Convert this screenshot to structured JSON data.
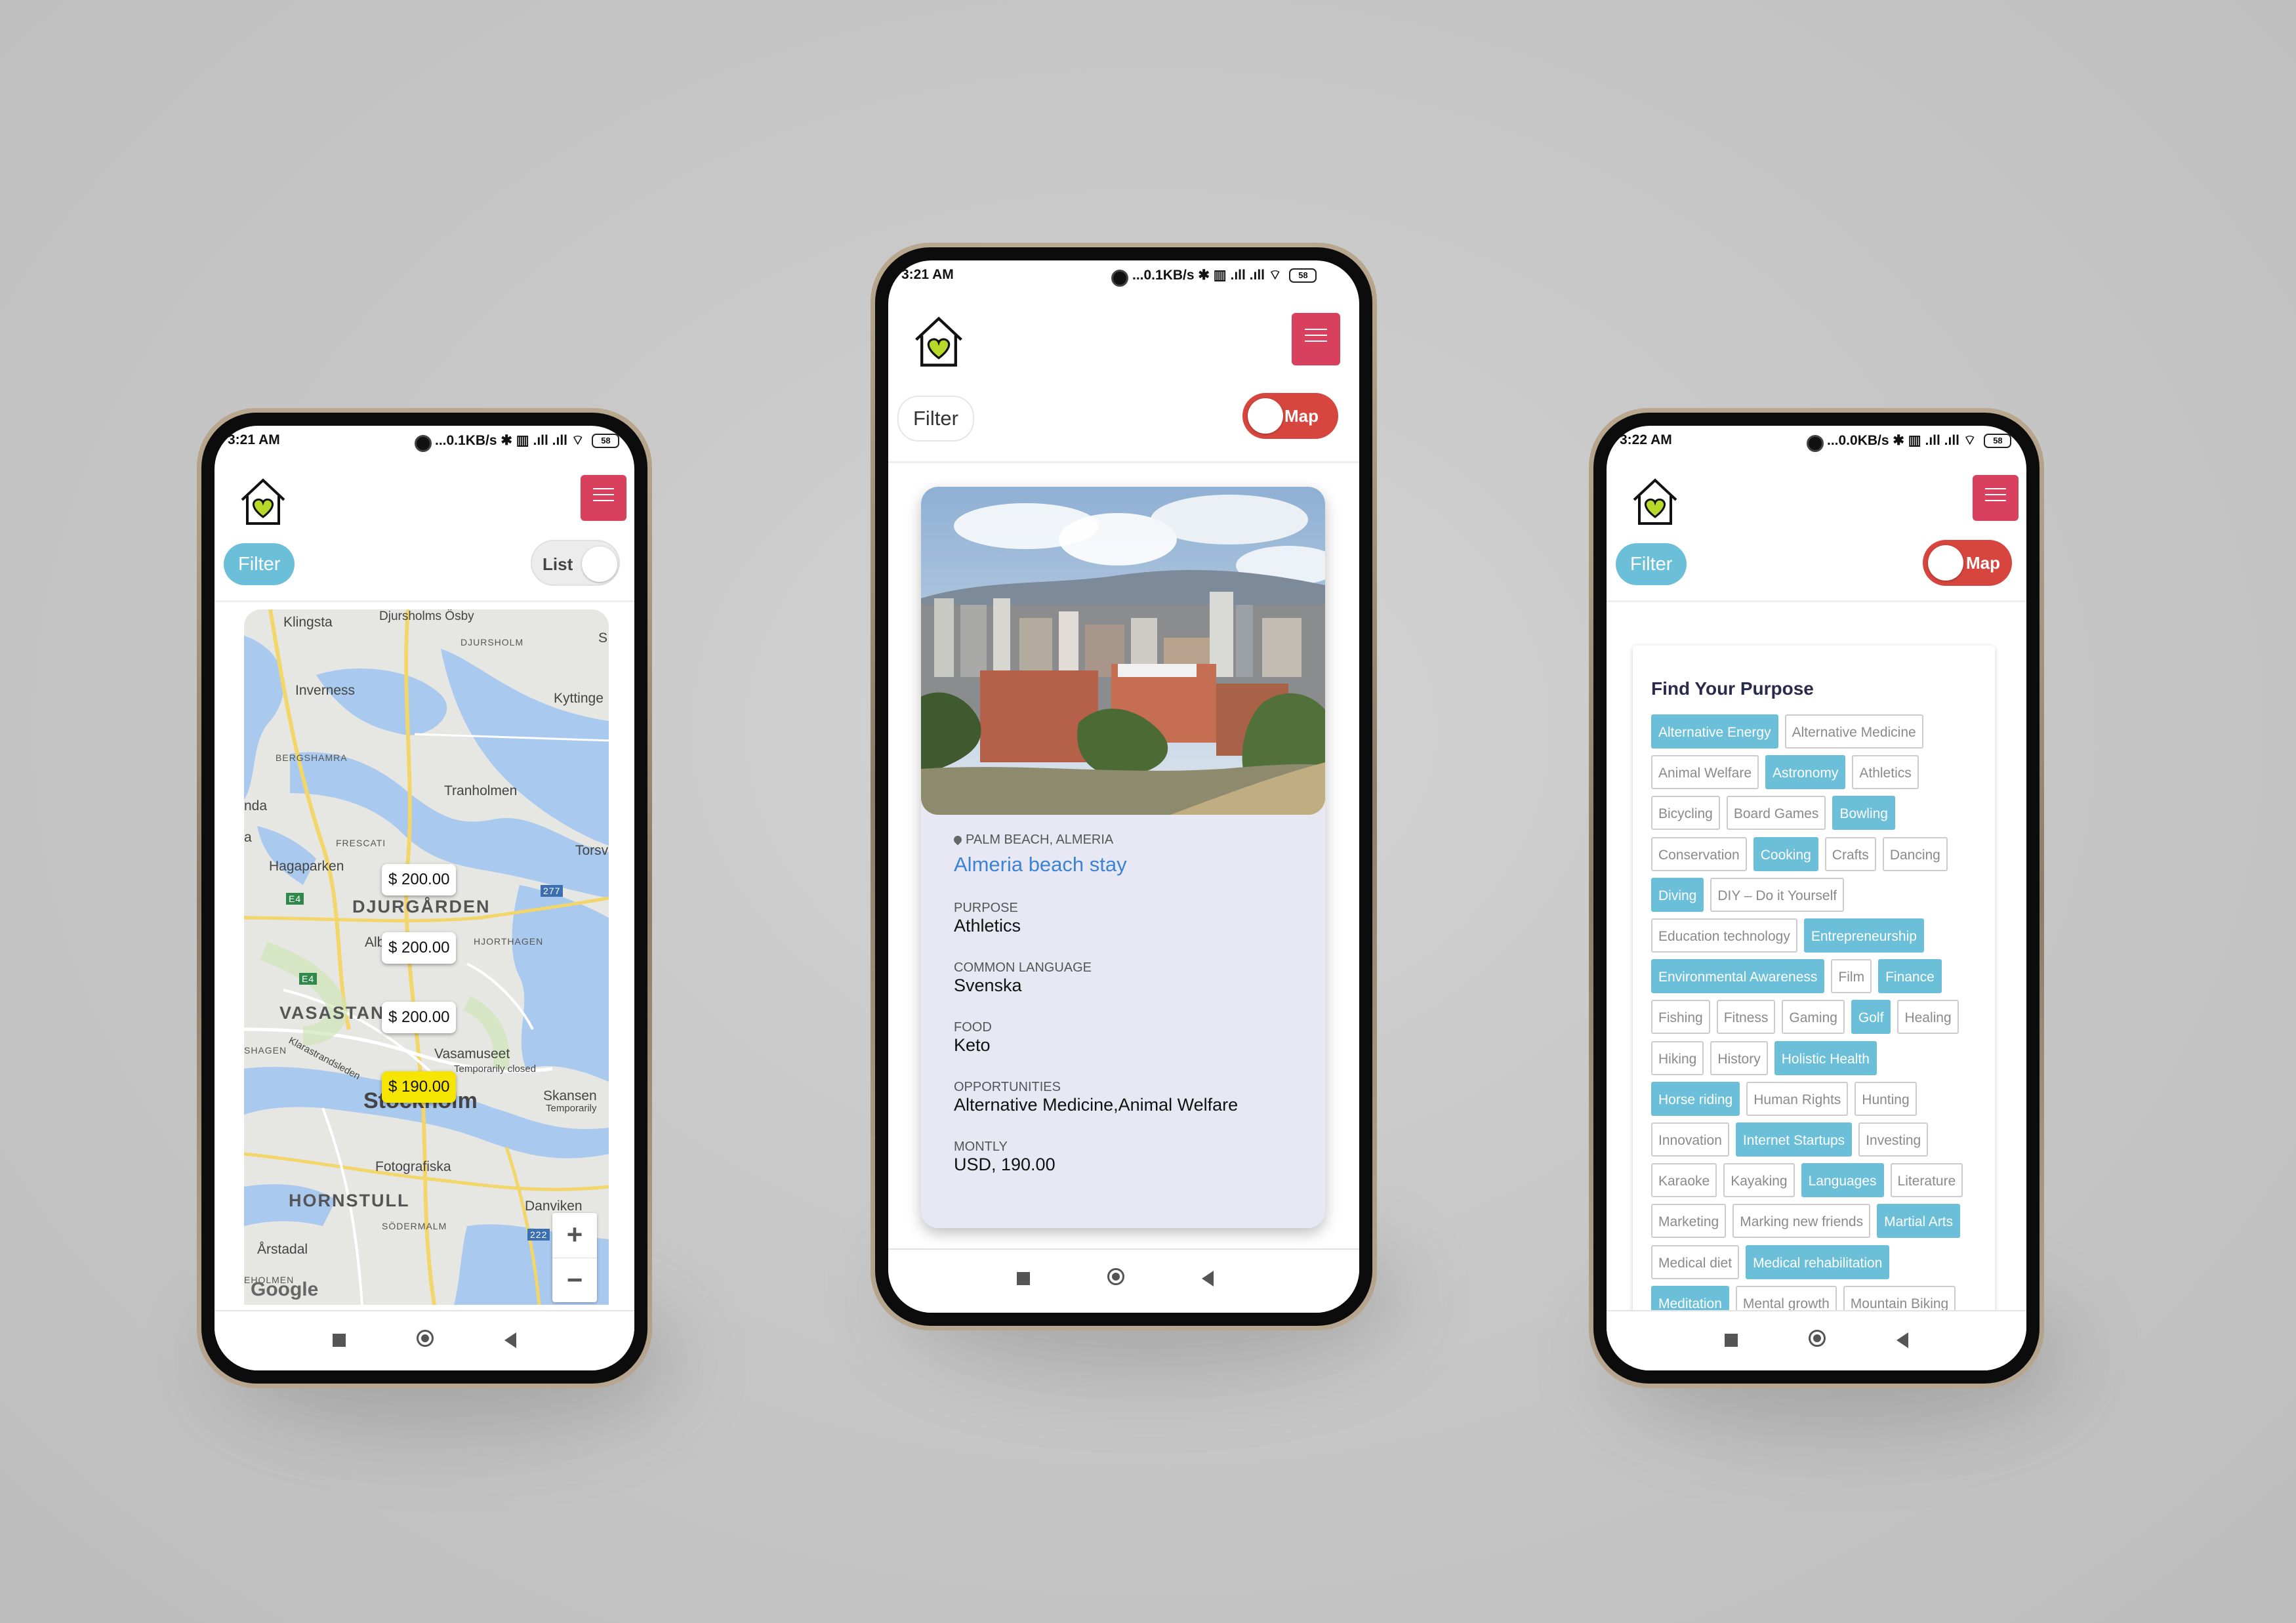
{
  "colors": {
    "accent_blue": "#6bbfd9",
    "brand_red": "#d8405e",
    "toggle_red": "#d6453e",
    "link_blue": "#3c83d4",
    "selected_pin": "#f5e500",
    "card_bg": "#e8e8f4"
  },
  "phone_left": {
    "status": {
      "time": "3:21 AM",
      "icons": "...0.1KB/s ✱ ▥ .ıll .ıll ⌔",
      "battery": "58"
    },
    "header": {
      "logo_icon": "house-heart-icon",
      "menu_icon": "hamburger-icon"
    },
    "filter_label": "Filter",
    "toggle_label": "List",
    "map": {
      "places": [
        "Klingsta",
        "Djursholms Ösby",
        "DJURSHOLM",
        "Inverness",
        "Kyttinge",
        "BERGSHAMRA",
        "Tranholmen",
        "nda",
        "a",
        "FRESCATI",
        "Torsv",
        "Hagaparken",
        "DJURGÅRDEN",
        "Alb",
        "HJORTHAGEN",
        "VASASTAN",
        "SHAGEN",
        "Klarastrandsleden",
        "Vasamuseet",
        "Temporarily closed",
        "Skansen",
        "Temporarily",
        "Stockholm",
        "Fotografiska",
        "HORNSTULL",
        "Danviken",
        "SÖDERMALM",
        "Årstadal",
        "EHOLMEN",
        "S",
        "Google"
      ],
      "road_badges": [
        "E4",
        "E4",
        "277",
        "222"
      ],
      "pins": [
        "$ 200.00",
        "$ 200.00",
        "$ 200.00",
        "$ 190.00"
      ],
      "zoom_in": "+",
      "zoom_out": "−"
    }
  },
  "phone_center": {
    "status": {
      "time": "3:21 AM",
      "icons": "...0.1KB/s ✱ ▥ .ıll .ıll ⌔",
      "battery": "58"
    },
    "filter_label": "Filter",
    "toggle_label": "Map",
    "listing": {
      "location": "PALM BEACH, ALMERIA",
      "title": "Almeria beach stay",
      "fields": [
        {
          "label": "PURPOSE",
          "value": "Athletics"
        },
        {
          "label": "COMMON LANGUAGE",
          "value": "Svenska"
        },
        {
          "label": "FOOD",
          "value": "Keto"
        },
        {
          "label": "OPPORTUNITIES",
          "value": "Alternative Medicine,Animal Welfare"
        },
        {
          "label": "MONTLY",
          "value": "USD, 190.00"
        }
      ]
    }
  },
  "phone_right": {
    "status": {
      "time": "3:22 AM",
      "icons": "...0.0KB/s ✱ ▥ .ıll .ıll ⌔",
      "battery": "58"
    },
    "filter_label": "Filter",
    "toggle_label": "Map",
    "purpose_title": "Find Your Purpose",
    "chips": [
      {
        "label": "Alternative Energy",
        "selected": true
      },
      {
        "label": "Alternative Medicine",
        "selected": false
      },
      {
        "label": "Animal Welfare",
        "selected": false
      },
      {
        "label": "Astronomy",
        "selected": true
      },
      {
        "label": "Athletics",
        "selected": false
      },
      {
        "label": "Bicycling",
        "selected": false
      },
      {
        "label": "Board Games",
        "selected": false
      },
      {
        "label": "Bowling",
        "selected": true
      },
      {
        "label": "Conservation",
        "selected": false
      },
      {
        "label": "Cooking",
        "selected": true
      },
      {
        "label": "Crafts",
        "selected": false
      },
      {
        "label": "Dancing",
        "selected": false
      },
      {
        "label": "Diving",
        "selected": true
      },
      {
        "label": "DIY – Do it Yourself",
        "selected": false
      },
      {
        "label": "Education technology",
        "selected": false
      },
      {
        "label": "Entrepreneurship",
        "selected": true
      },
      {
        "label": "Environmental Awareness",
        "selected": true
      },
      {
        "label": "Film",
        "selected": false
      },
      {
        "label": "Finance",
        "selected": true
      },
      {
        "label": "Fishing",
        "selected": false
      },
      {
        "label": "Fitness",
        "selected": false
      },
      {
        "label": "Gaming",
        "selected": false
      },
      {
        "label": "Golf",
        "selected": true
      },
      {
        "label": "Healing",
        "selected": false
      },
      {
        "label": "Hiking",
        "selected": false
      },
      {
        "label": "History",
        "selected": false
      },
      {
        "label": "Holistic Health",
        "selected": true
      },
      {
        "label": "Horse riding",
        "selected": true
      },
      {
        "label": "Human Rights",
        "selected": false
      },
      {
        "label": "Hunting",
        "selected": false
      },
      {
        "label": "Innovation",
        "selected": false
      },
      {
        "label": "Internet Startups",
        "selected": true
      },
      {
        "label": "Investing",
        "selected": false
      },
      {
        "label": "Karaoke",
        "selected": false
      },
      {
        "label": "Kayaking",
        "selected": false
      },
      {
        "label": "Languages",
        "selected": true
      },
      {
        "label": "Literature",
        "selected": false
      },
      {
        "label": "Marketing",
        "selected": false
      },
      {
        "label": "Marking new friends",
        "selected": false
      },
      {
        "label": "Martial Arts",
        "selected": true
      },
      {
        "label": "Medical diet",
        "selected": false
      },
      {
        "label": "Medical rehabilitation",
        "selected": true
      },
      {
        "label": "Meditation",
        "selected": true
      },
      {
        "label": "Mental growth",
        "selected": false
      },
      {
        "label": "Mountain Biking",
        "selected": false
      }
    ]
  }
}
